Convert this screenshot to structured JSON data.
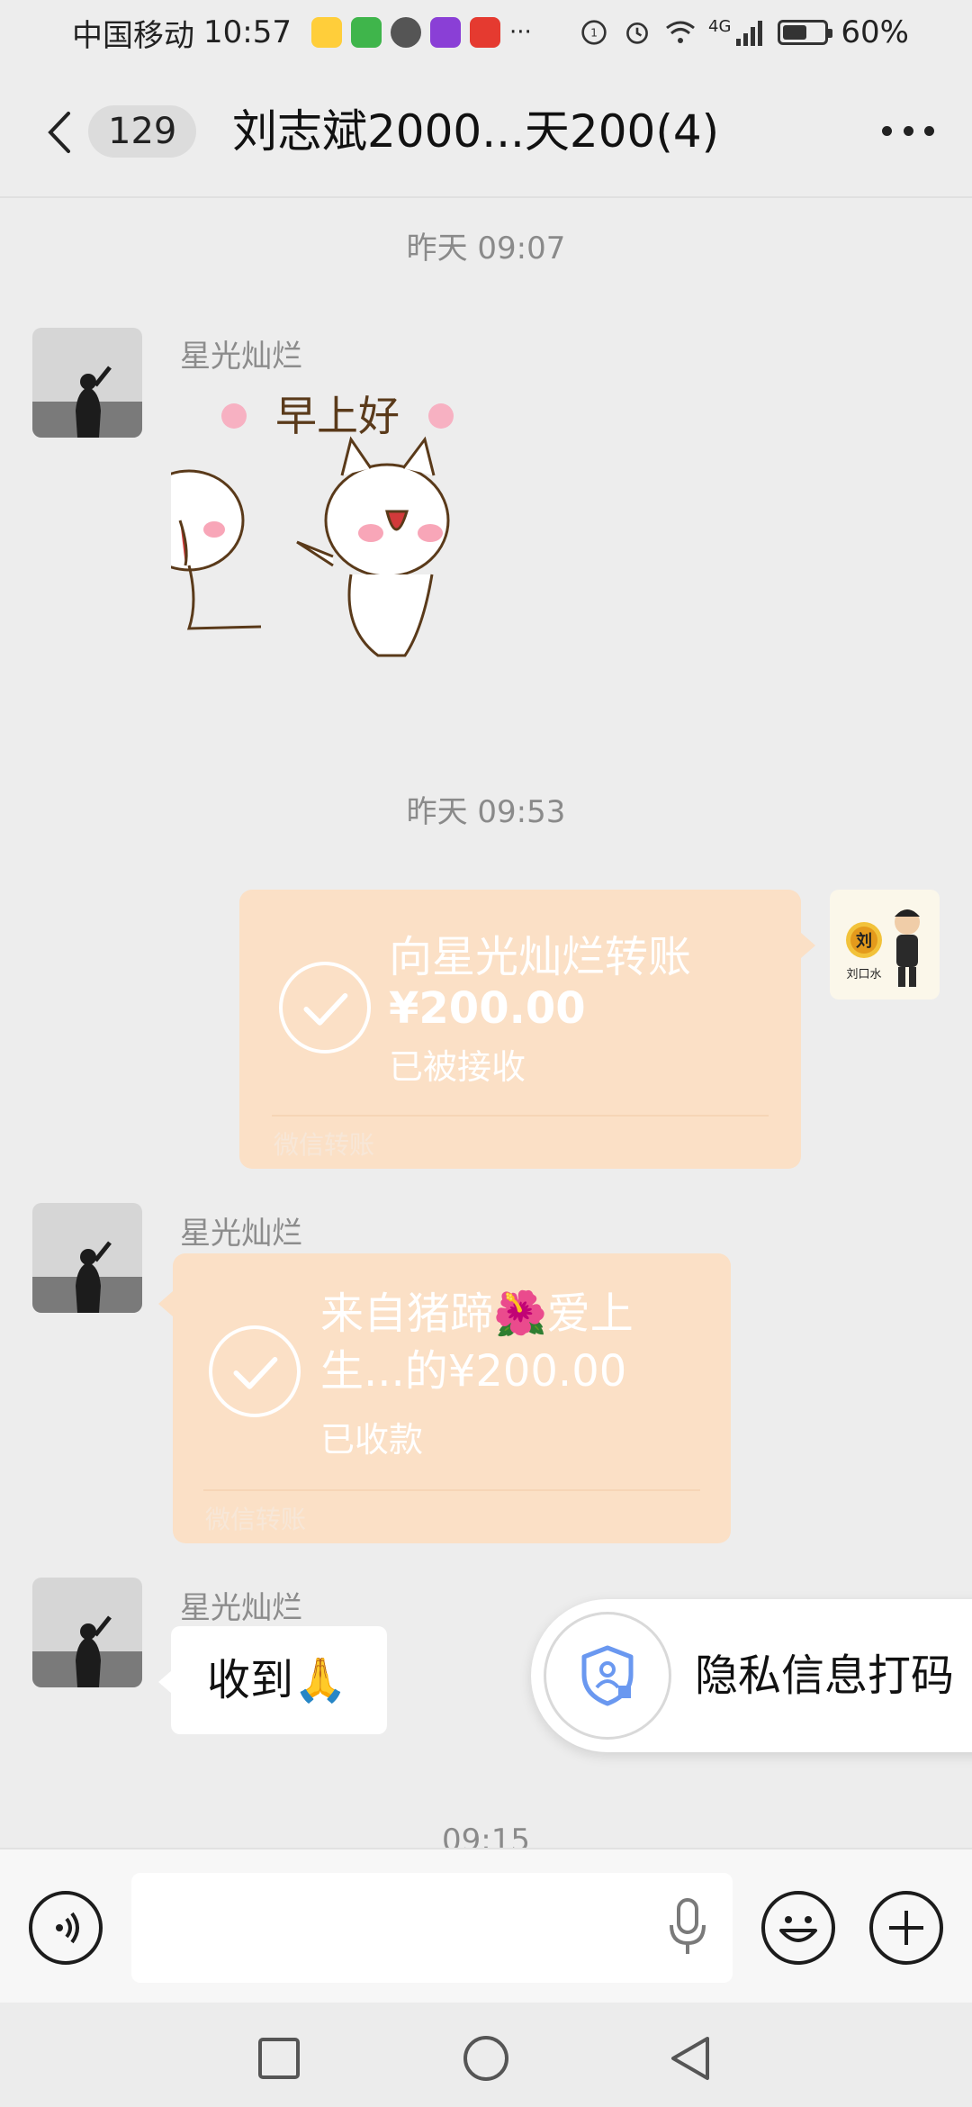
{
  "status_bar": {
    "carrier": "中国移动",
    "time": "10:57",
    "more": "···",
    "network": "4G",
    "battery_text": "60%",
    "battery_level": 0.6
  },
  "header": {
    "unread_count": "129",
    "title": "刘志斌2000...天200(4)"
  },
  "messages": {
    "ts1": "昨天 09:07",
    "sender1": "星光灿烂",
    "sticker_text": "早上好",
    "ts2": "昨天 09:53",
    "transfer_out": {
      "title": "向星光灿烂转账",
      "amount": "¥200.00",
      "status": "已被接收",
      "footer": "微信转账"
    },
    "my_avatar_text": "刘口水",
    "my_avatar_char": "刘",
    "sender2": "星光灿烂",
    "transfer_in": {
      "line1": "来自猪蹄🌺爱上",
      "line2": "生...的¥200.00",
      "status": "已收款",
      "footer": "微信转账"
    },
    "sender3": "星光灿烂",
    "received_text": "收到🙏",
    "ts3": "09:15"
  },
  "privacy_button": {
    "label": "隐私信息打码"
  },
  "colors": {
    "background": "#ededed",
    "transfer_bubble": "#fbe0c6",
    "privacy_icon": "#6a98f0"
  }
}
